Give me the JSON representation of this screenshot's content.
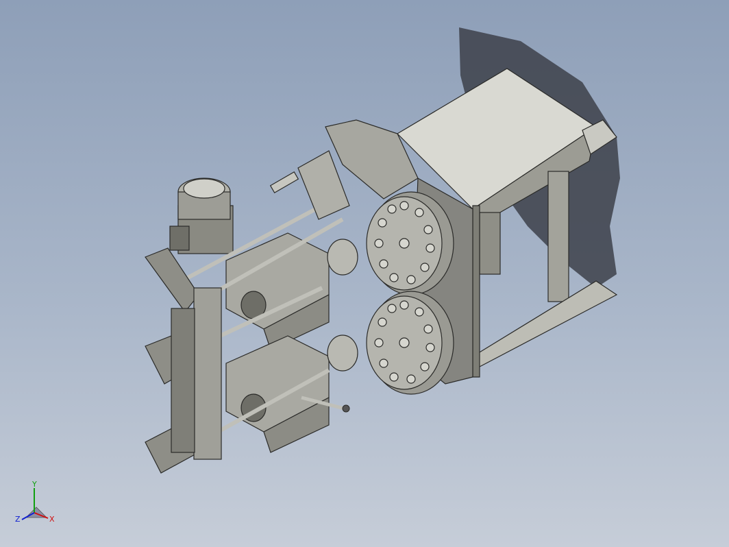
{
  "viewport": {
    "background_top": "#8e9fb8",
    "background_bottom": "#c6cdd8",
    "model_color": "#8a8a82",
    "shadow_color": "#3b3f47"
  },
  "triad": {
    "x_label": "X",
    "y_label": "Y",
    "z_label": "Z",
    "x_color": "#d01010",
    "y_color": "#10a010",
    "z_color": "#1020d0"
  }
}
